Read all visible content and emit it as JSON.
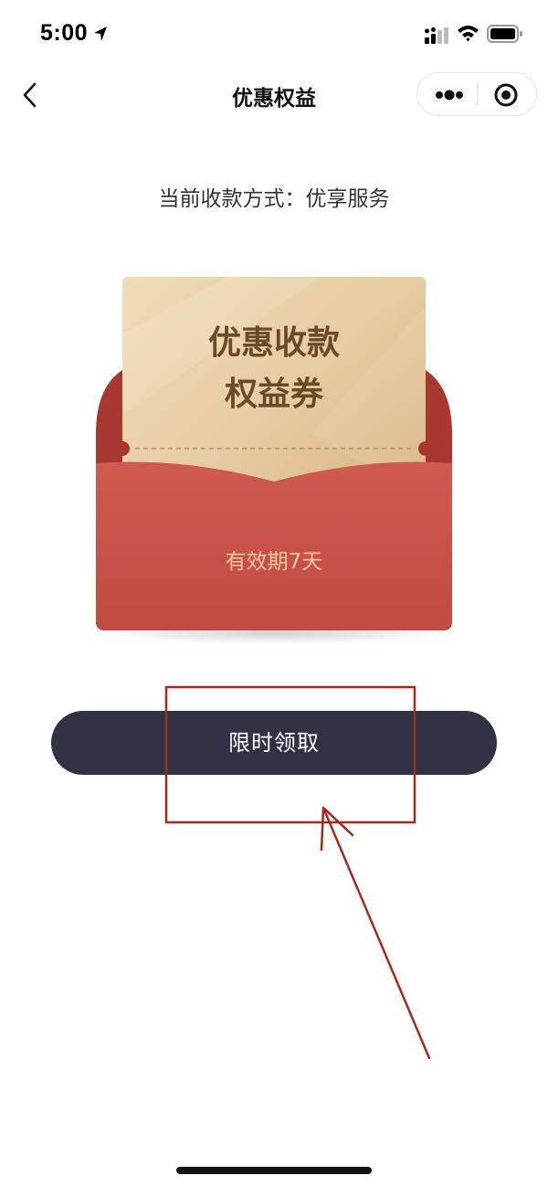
{
  "status_bar": {
    "time": "5:00",
    "icons": [
      "location-arrow-icon",
      "signal-icon",
      "wifi-icon",
      "battery-icon"
    ]
  },
  "nav": {
    "title": "优惠权益",
    "icons": [
      "back-chevron-icon",
      "more-dots-icon",
      "close-circle-icon"
    ]
  },
  "payment_method": "当前收款方式：优享服务",
  "coupon": {
    "title_line1": "优惠收款",
    "title_line2": "权益券",
    "validity": "有效期7天"
  },
  "claim_button": {
    "label": "限时领取"
  },
  "colors": {
    "envelope_red": "#c8514a",
    "envelope_back": "#a93c35",
    "coupon_gold": "#e8cfa3",
    "coupon_text": "#6b4a26",
    "validity_text": "#f7c99b",
    "button_bg": "#313244",
    "annotation": "#a8281c"
  }
}
